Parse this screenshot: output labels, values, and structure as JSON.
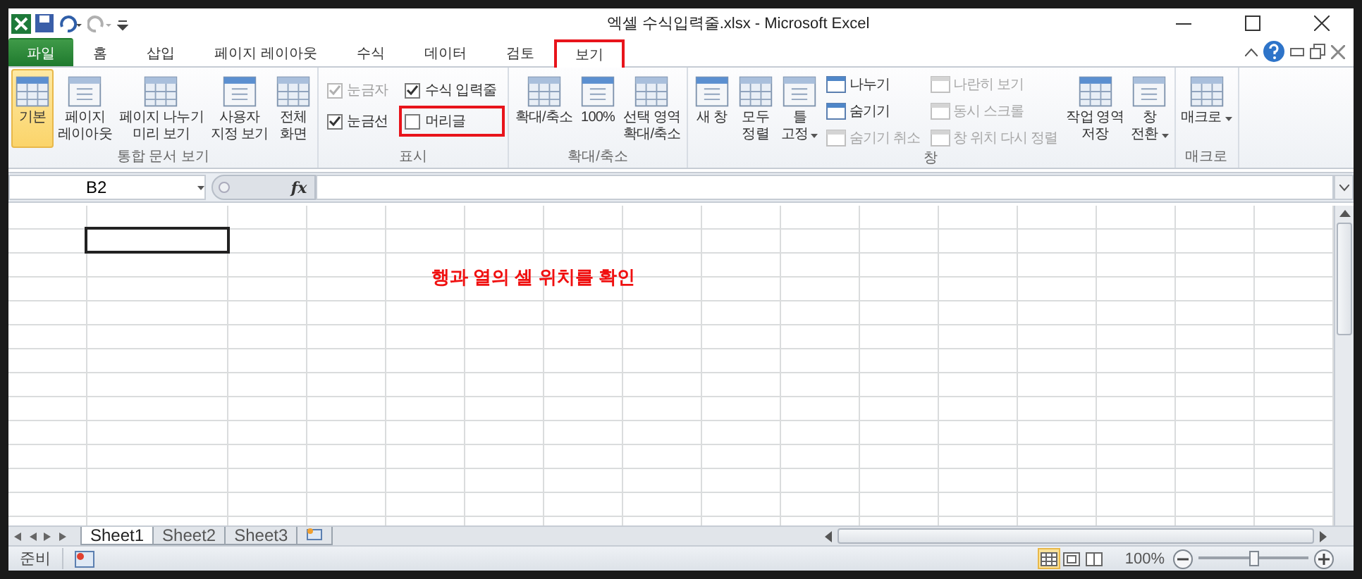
{
  "window": {
    "title": "엑셀 수식입력줄.xlsx  -  Microsoft Excel"
  },
  "ribbon_tabs": [
    {
      "label": "파일",
      "kind": "file",
      "selected": false,
      "highlighted": false
    },
    {
      "label": "홈",
      "kind": "tab",
      "selected": false,
      "highlighted": false
    },
    {
      "label": "삽입",
      "kind": "tab",
      "selected": false,
      "highlighted": false
    },
    {
      "label": "페이지 레이아웃",
      "kind": "tab",
      "selected": false,
      "highlighted": false
    },
    {
      "label": "수식",
      "kind": "tab",
      "selected": false,
      "highlighted": false
    },
    {
      "label": "데이터",
      "kind": "tab",
      "selected": false,
      "highlighted": false
    },
    {
      "label": "검토",
      "kind": "tab",
      "selected": false,
      "highlighted": false
    },
    {
      "label": "보기",
      "kind": "tab",
      "selected": true,
      "highlighted": true
    }
  ],
  "ribbon_groups": [
    {
      "title": "통합 문서 보기",
      "items": [
        {
          "kind": "large",
          "label": "기본",
          "selected": true
        },
        {
          "kind": "large",
          "label": "페이지\n레이아웃",
          "selected": false
        },
        {
          "kind": "large",
          "label": "페이지 나누기\n미리 보기",
          "selected": false
        },
        {
          "kind": "large",
          "label": "사용자\n지정 보기",
          "selected": false
        },
        {
          "kind": "large",
          "label": "전체\n화면",
          "selected": false
        }
      ]
    },
    {
      "title": "표시",
      "items": [
        {
          "kind": "check",
          "label": "눈금자",
          "checked": true,
          "disabled": true,
          "highlighted": false
        },
        {
          "kind": "check",
          "label": "눈금선",
          "checked": true,
          "disabled": false,
          "highlighted": false
        },
        {
          "kind": "check",
          "label": "수식 입력줄",
          "checked": true,
          "disabled": false,
          "highlighted": false
        },
        {
          "kind": "check",
          "label": "머리글",
          "checked": false,
          "disabled": false,
          "highlighted": true
        }
      ]
    },
    {
      "title": "확대/축소",
      "items": [
        {
          "kind": "large",
          "label": "확대/축소",
          "selected": false
        },
        {
          "kind": "large",
          "label": "100%",
          "selected": false
        },
        {
          "kind": "large",
          "label": "선택 영역\n확대/축소",
          "selected": false
        }
      ]
    },
    {
      "title": "창",
      "items": [
        {
          "kind": "large",
          "label": "새 창",
          "selected": false
        },
        {
          "kind": "large",
          "label": "모두\n정렬",
          "selected": false
        },
        {
          "kind": "large",
          "label": "틀\n고정",
          "selected": false,
          "dropdown": true
        },
        {
          "kind": "small",
          "label": "나누기",
          "disabled": false
        },
        {
          "kind": "small",
          "label": "숨기기",
          "disabled": false
        },
        {
          "kind": "small",
          "label": "숨기기 취소",
          "disabled": true
        },
        {
          "kind": "small",
          "label": "나란히 보기",
          "disabled": true
        },
        {
          "kind": "small",
          "label": "동시 스크롤",
          "disabled": true
        },
        {
          "kind": "small",
          "label": "창 위치 다시 정렬",
          "disabled": true
        },
        {
          "kind": "large",
          "label": "작업 영역\n저장",
          "selected": false
        },
        {
          "kind": "large",
          "label": "창\n전환",
          "selected": false,
          "dropdown": true
        }
      ]
    },
    {
      "title": "매크로",
      "items": [
        {
          "kind": "large",
          "label": "매크로",
          "selected": false,
          "dropdown": true
        }
      ]
    }
  ],
  "formula_bar": {
    "name_box": "B2",
    "function_label": "fx"
  },
  "annotation": "행과 열의 셀 위치를 확인",
  "sheet_tabs": [
    {
      "label": "Sheet1",
      "selected": true
    },
    {
      "label": "Sheet2",
      "selected": false
    },
    {
      "label": "Sheet3",
      "selected": false
    }
  ],
  "status_bar": {
    "status": "준비",
    "views": [
      {
        "selected": true
      },
      {
        "selected": false
      },
      {
        "selected": false
      }
    ],
    "zoom": "100%",
    "zoom_slider": {
      "level": 0.5
    }
  }
}
